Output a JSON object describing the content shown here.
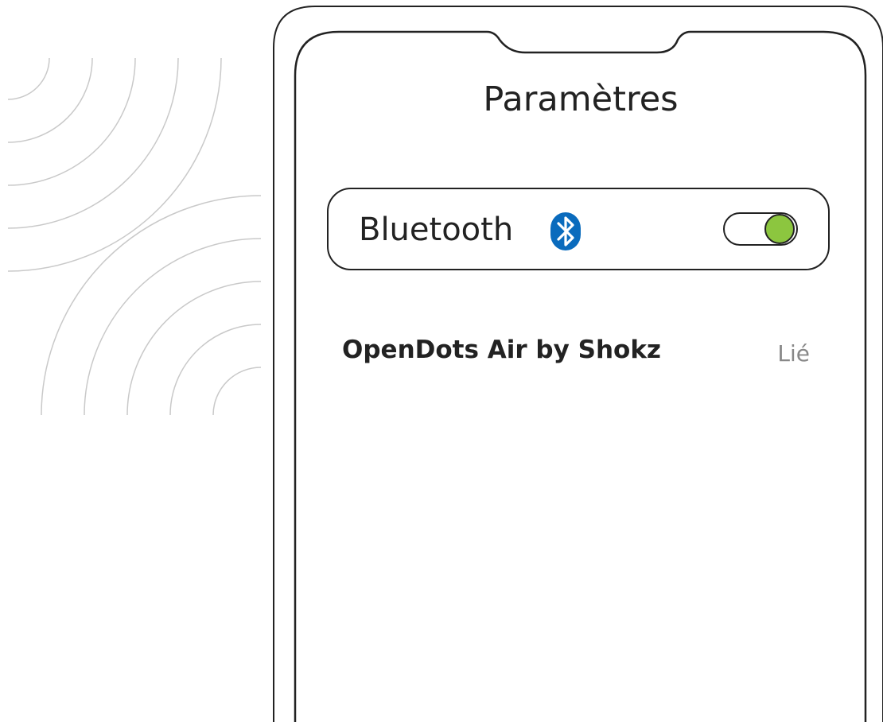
{
  "screen": {
    "title": "Paramètres"
  },
  "bluetooth": {
    "label": "Bluetooth",
    "icon": "bluetooth-icon",
    "enabled": true,
    "toggle_color": "#8cc63f"
  },
  "devices": [
    {
      "name": "OpenDots Air by Shokz",
      "status": "Lié"
    }
  ],
  "colors": {
    "outline": "#222222",
    "bluetooth_brand": "#0a6bbd",
    "status_text": "#888888"
  }
}
